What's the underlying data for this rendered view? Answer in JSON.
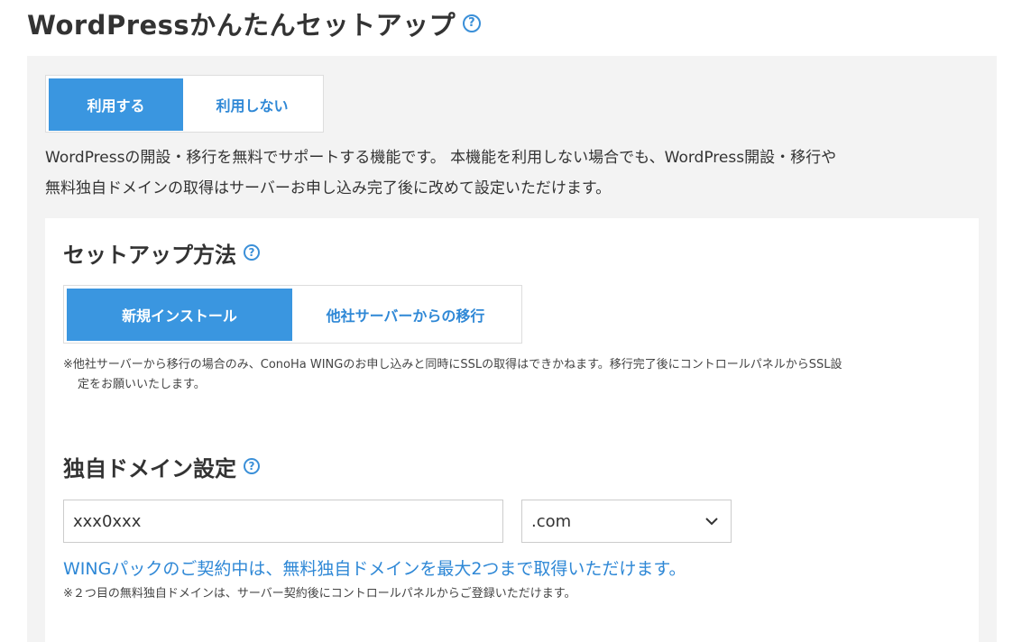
{
  "page": {
    "title": "WordPressかんたんセットアップ",
    "help": "?"
  },
  "use_toggle": {
    "use_label": "利用する",
    "no_use_label": "利用しない",
    "selected": "利用する"
  },
  "description": {
    "line1": "WordPressの開設・移行を無料でサポートする機能です。 本機能を利用しない場合でも、WordPress開設・移行や",
    "line2": "無料独自ドメインの取得はサーバーお申し込み完了後に改めて設定いただけます。"
  },
  "setup_method": {
    "title": "セットアップ方法",
    "help": "?",
    "new_install_label": "新規インストール",
    "migrate_label": "他社サーバーからの移行",
    "selected": "新規インストール",
    "note_line1": "※他社サーバーから移行の場合のみ、ConoHa WINGのお申し込みと同時にSSLの取得はできかねます。移行完了後にコントロールパネルからSSL設",
    "note_line2": "定をお願いいたします。"
  },
  "domain": {
    "title": "独自ドメイン設定",
    "help": "?",
    "input_value": "xxx0xxx",
    "tld_selected": ".com",
    "info": "WINGパックのご契約中は、無料独自ドメインを最大2つまで取得いただけます。",
    "note": "※２つ目の無料独自ドメインは、サーバー契約後にコントロールパネルからご登録いただけます。"
  },
  "colors": {
    "accent": "#3a96e0",
    "link": "#2f88d6",
    "panel_bg": "#f3f3f3"
  }
}
